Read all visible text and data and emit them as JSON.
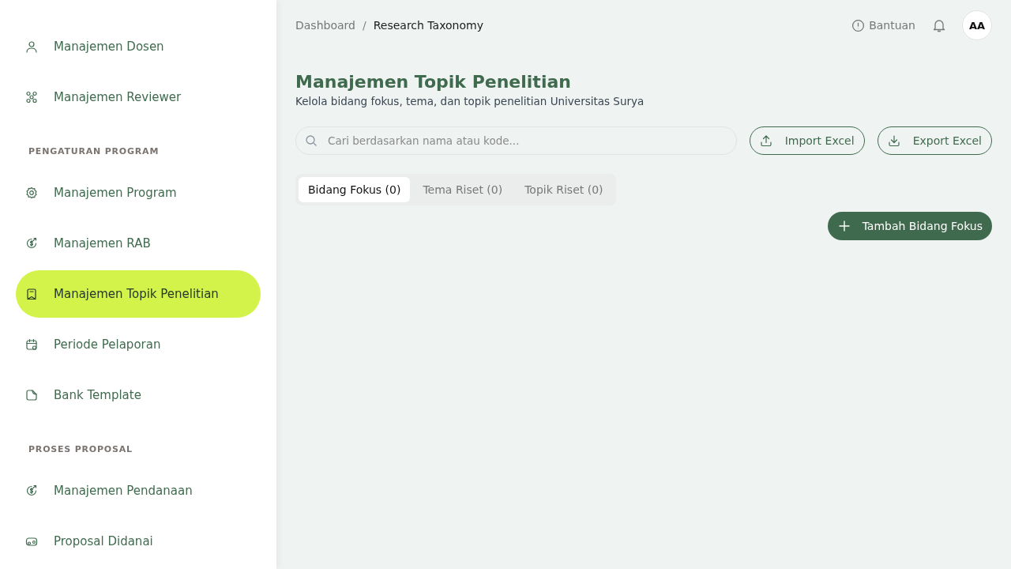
{
  "sidebar": {
    "sections": [
      {
        "items": [
          {
            "label": "Manajemen Dosen",
            "selected": false
          },
          {
            "label": "Manajemen Reviewer",
            "selected": false
          }
        ]
      },
      {
        "heading": "PENGATURAN PROGRAM",
        "items": [
          {
            "label": "Manajemen Program",
            "selected": false
          },
          {
            "label": "Manajemen RAB",
            "selected": false
          },
          {
            "label": "Manajemen Topik Penelitian",
            "selected": true
          },
          {
            "label": "Periode Pelaporan",
            "selected": false
          },
          {
            "label": "Bank Template",
            "selected": false
          }
        ]
      },
      {
        "heading": "PROSES PROPOSAL",
        "items": [
          {
            "label": "Manajemen Pendanaan",
            "selected": false
          },
          {
            "label": "Proposal Didanai",
            "selected": false
          }
        ]
      }
    ]
  },
  "breadcrumb": {
    "items": [
      "Dashboard",
      "Research Taxonomy"
    ],
    "separator": "/"
  },
  "header": {
    "help": "Bantuan",
    "avatar": "AA"
  },
  "page": {
    "title": "Manajemen Topik Penelitian",
    "subtitle": "Kelola bidang fokus, tema, dan topik penelitian Universitas Surya"
  },
  "search": {
    "placeholder": "Cari berdasarkan nama atau kode..."
  },
  "actions": [
    "Import Excel",
    "Export Excel"
  ],
  "tabs": [
    {
      "label": "Bidang Fokus (0)",
      "selected": true
    },
    {
      "label": "Tema Riset (0)",
      "selected": false
    },
    {
      "label": "Topik Riset (0)",
      "selected": false
    }
  ],
  "add_button": "Tambah Bidang Fokus"
}
